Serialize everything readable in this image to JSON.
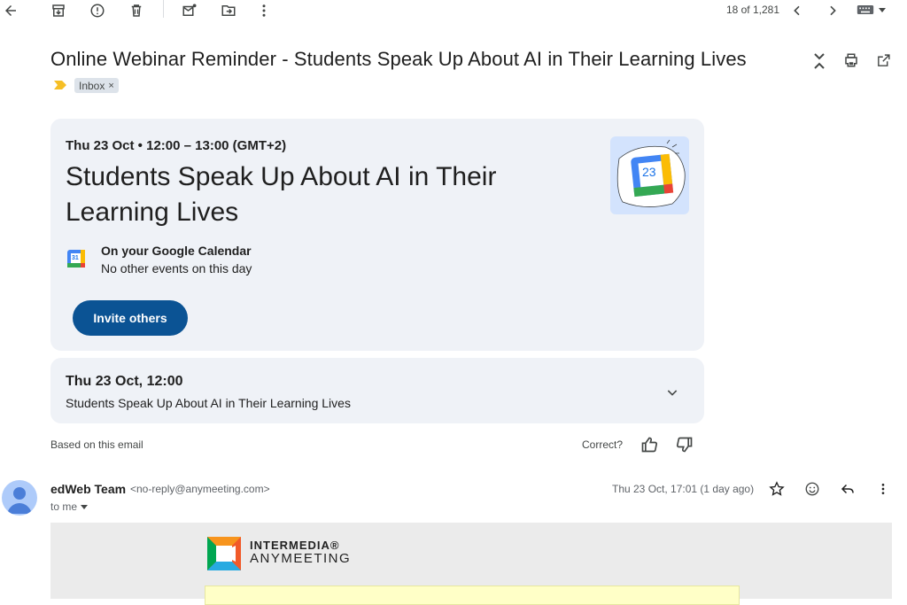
{
  "toolbar": {
    "icons": [
      "back-arrow-icon",
      "archive-icon",
      "report-spam-icon",
      "delete-icon",
      "mark-unread-icon",
      "move-to-icon",
      "more-vert-icon"
    ],
    "pager": "18 of 1,281",
    "input_tools": "keyboard-icon"
  },
  "email": {
    "subject": "Online Webinar Reminder - Students Speak Up About AI in Their Learning Lives",
    "label": "Inbox",
    "label_remove": "×",
    "importance_color": "#f6bf26"
  },
  "event_card": {
    "datetime": "Thu 23 Oct • 12:00 – 13:00 (GMT+2)",
    "title": "Students Speak Up About AI in Their Learning Lives",
    "calendar_heading": "On your Google Calendar",
    "calendar_status": "No other events on this day",
    "calendar_day": "23",
    "small_icon_day": "31",
    "invite_label": "Invite others"
  },
  "event_summary": {
    "date": "Thu 23 Oct, 12:00",
    "title": "Students Speak Up About AI in Their Learning Lives"
  },
  "feedback": {
    "based": "Based on this email",
    "correct": "Correct?"
  },
  "message": {
    "sender_name": "edWeb Team",
    "sender_email": "<no-reply@anymeeting.com>",
    "to": "to me",
    "date": "Thu 23 Oct, 17:01 (1 day ago)"
  },
  "body": {
    "brand_line1": "INTERMEDIA®",
    "brand_line2": "ANYMEETING"
  },
  "colors": {
    "invite_button": "#0b5394",
    "card_bg": "#eff2f7",
    "accent_blue": "#1a73e8"
  }
}
